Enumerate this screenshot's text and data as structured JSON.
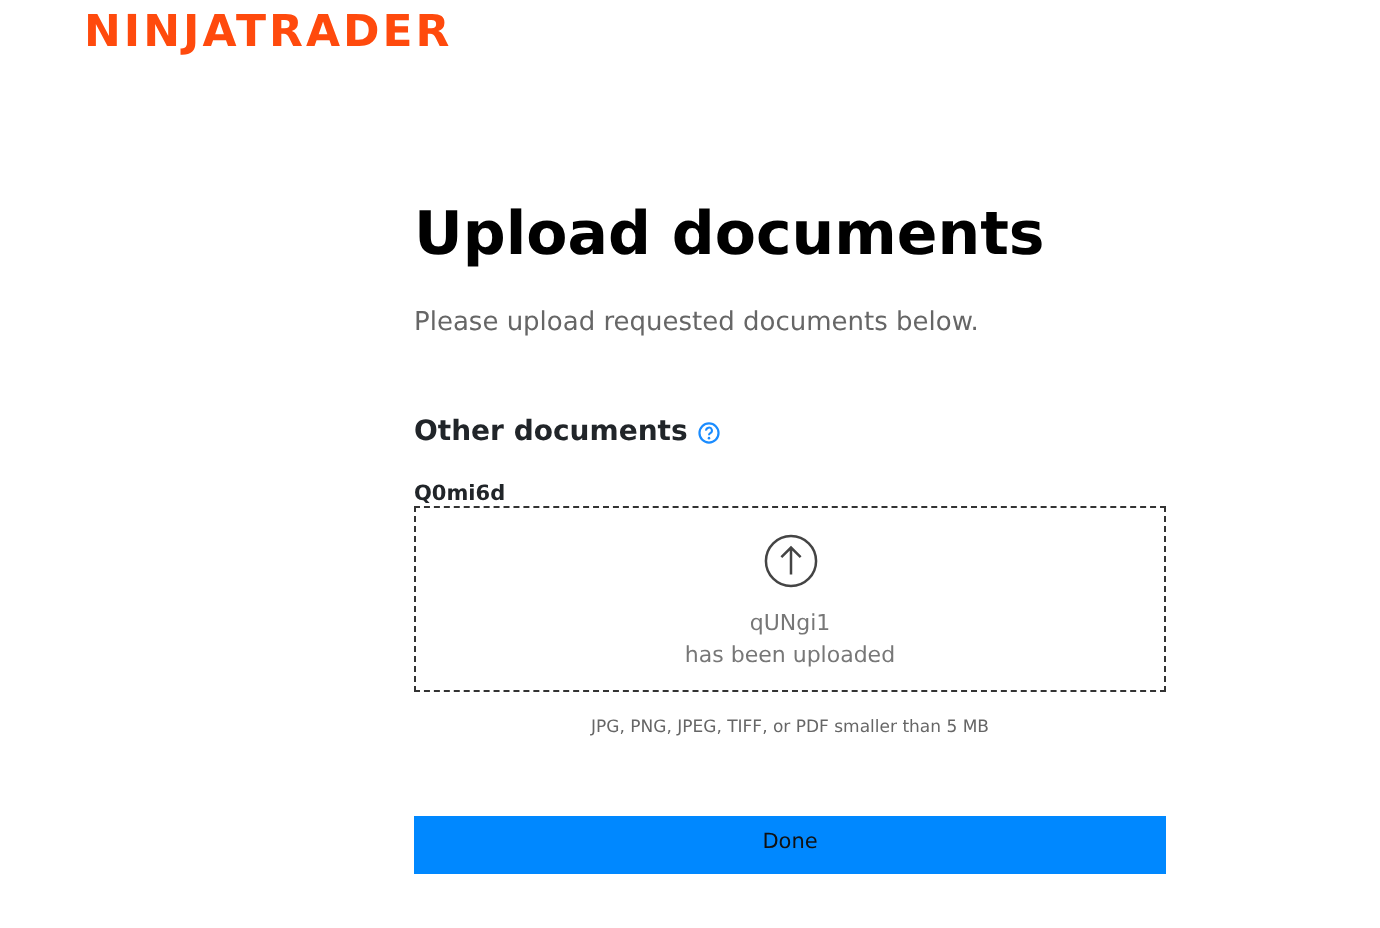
{
  "logo": "NINJATRADER",
  "title": "Upload documents",
  "subtitle": "Please upload requested documents below.",
  "section": {
    "heading": "Other documents",
    "field_label": "Q0mi6d",
    "file_name": "qUNgi1",
    "status": "has been uploaded",
    "hint": "JPG, PNG, JPEG, TIFF, or PDF smaller than 5 MB"
  },
  "buttons": [
    "Done"
  ]
}
